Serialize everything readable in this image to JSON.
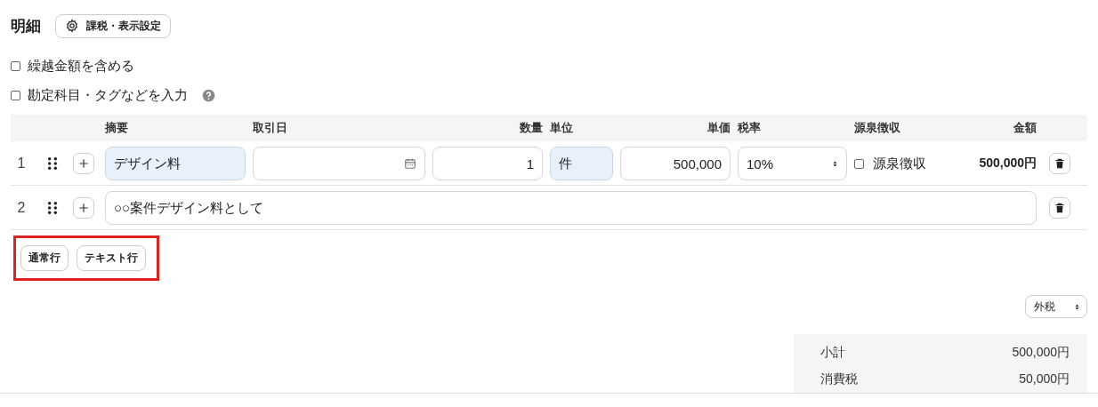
{
  "title": "明細",
  "settings_button": "課税・表示設定",
  "options": [
    {
      "label": "繰越金額を含める",
      "checked": false,
      "help": false
    },
    {
      "label": "勘定科目・タグなどを入力",
      "checked": false,
      "help": true
    }
  ],
  "table": {
    "columns": [
      "摘要",
      "取引日",
      "数量",
      "単位",
      "単価",
      "税率",
      "源泉徴収",
      "金額"
    ],
    "rows": [
      {
        "kind": "item",
        "number": "1",
        "description": {
          "value": "デザイン料",
          "autofilled": true
        },
        "quantity": "1",
        "unit": {
          "value": "件",
          "autofilled": true
        },
        "unit_price": "500,000",
        "tax_rate": "10%",
        "withholding": {
          "label": "源泉徴収",
          "checked": false
        },
        "amount": "500,000円"
      },
      {
        "kind": "text",
        "number": "2",
        "text": "○○案件デザイン料として"
      }
    ]
  },
  "add_buttons": {
    "highlighted": true,
    "items": [
      "通常行",
      "テキスト行"
    ]
  },
  "tax_mode": "外税",
  "summary": [
    {
      "label": "小計",
      "value": "500,000円"
    },
    {
      "label": "消費税",
      "value": "50,000円"
    }
  ]
}
